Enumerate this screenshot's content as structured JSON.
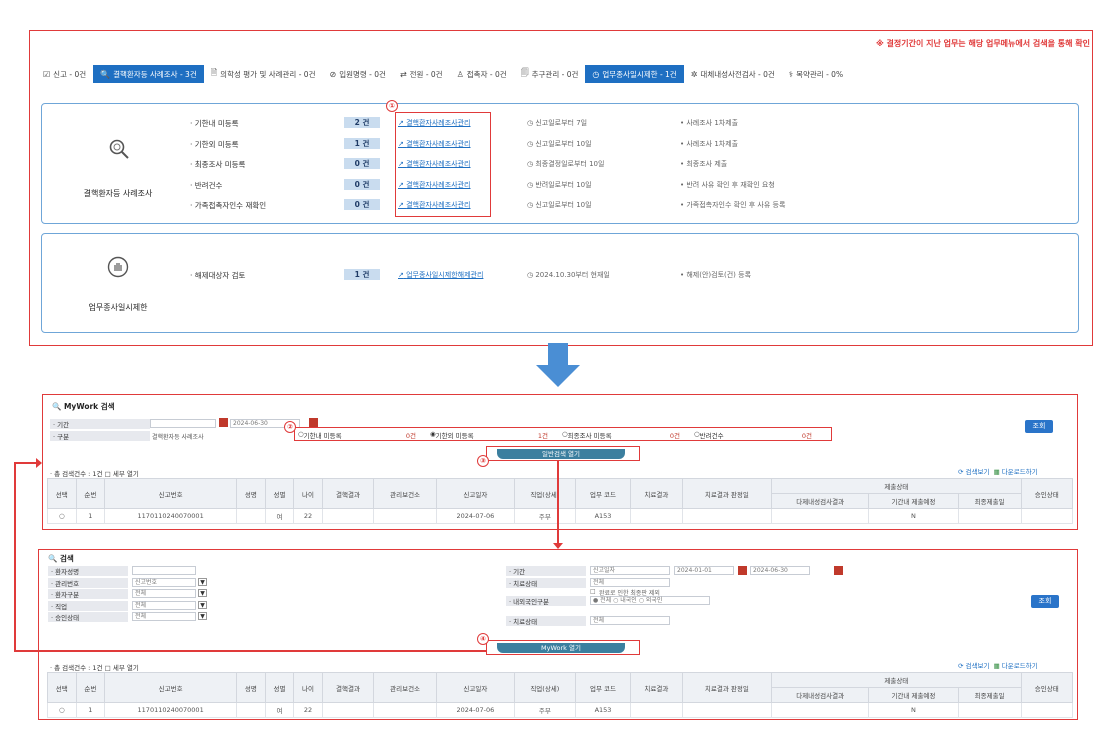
{
  "notice": "※ 결정기간이 지난 업무는 해당 업무메뉴에서 검색을 통해 확인",
  "tabs": [
    {
      "icon": "edit-icon",
      "glyph": "☑",
      "label": "신고 - 0건",
      "active": false
    },
    {
      "icon": "search-icon",
      "glyph": "🔍",
      "label": "결핵환자등 사례조사 - 3건",
      "active": true
    },
    {
      "icon": "document-icon",
      "glyph": "🗎",
      "label": "의학성 평가 및 사례관리 - 0건",
      "active": false
    },
    {
      "icon": "check-icon",
      "glyph": "⊘",
      "label": "입원명령 - 0건",
      "active": false
    },
    {
      "icon": "link-icon",
      "glyph": "⇄",
      "label": "전원 - 0건",
      "active": false
    },
    {
      "icon": "person-icon",
      "glyph": "♙",
      "label": "접촉자 - 0건",
      "active": false
    },
    {
      "icon": "clipboard-icon",
      "glyph": "🗐",
      "label": "추구관리 - 0건",
      "active": false
    },
    {
      "icon": "clock-icon",
      "glyph": "◷",
      "label": "업무종사일시제한 - 1건",
      "active": true
    },
    {
      "icon": "gear-icon",
      "glyph": "✲",
      "label": "대체내성사전검사 - 0건",
      "active": false
    },
    {
      "icon": "pill-icon",
      "glyph": "⚕",
      "label": "복약관리 - 0%",
      "active": false
    }
  ],
  "panel1": {
    "title": "결핵환자등 사례조사",
    "rows": [
      {
        "label": "· 기한내 미등록",
        "count": "2 건",
        "link": "결핵환자사례조사관리",
        "deadline": "신고일로부터 7일",
        "desc": "• 사례조사 1차제출"
      },
      {
        "label": "· 기한외 미등록",
        "count": "1 건",
        "link": "결핵환자사례조사관리",
        "deadline": "신고일로부터 10일",
        "desc": "• 사례조사 1차제출"
      },
      {
        "label": "· 최종조사 미등록",
        "count": "0 건",
        "link": "결핵환자사례조사관리",
        "deadline": "최종결정일로부터 10일",
        "desc": "• 최종조사 제출"
      },
      {
        "label": "· 반려건수",
        "count": "0 건",
        "link": "결핵환자사례조사관리",
        "deadline": "반려일로부터 10일",
        "desc": "• 반려 사유 확인 후 재확인 요청"
      },
      {
        "label": "· 가족접촉자인수 재확인",
        "count": "0 건",
        "link": "결핵환자사례조사관리",
        "deadline": "신고일로부터 10일",
        "desc": "• 가족접촉자인수 확인 후 사유 등록"
      }
    ]
  },
  "panel2": {
    "title": "업무종사일시제한",
    "row": {
      "label": "· 해제대상자 검토",
      "count": "1 건",
      "link": "업무종사일시제한해제관리",
      "deadline": "2024.10.30부터 현재일",
      "desc": "• 해제(안)검토(건) 등록"
    }
  },
  "markers": [
    "①",
    "②",
    "③",
    "④"
  ],
  "mywork": {
    "title": "MyWork 검색",
    "period_label": "· 기간",
    "date_from": "",
    "date_to": "2024-06-30",
    "type_label": "· 구분",
    "type_value": "결핵환자등 사례조사",
    "radios": [
      {
        "label": "기한내 미등록",
        "count": "0건",
        "checked": false
      },
      {
        "label": "기한외 미등록",
        "count": "1건",
        "checked": true
      },
      {
        "label": "최종조사 미등록",
        "count": "0건",
        "checked": false
      },
      {
        "label": "반려건수",
        "count": "0건",
        "checked": false
      }
    ],
    "search_btn": "조회",
    "toggle_label": "일반검색 열기",
    "total_label": "· 총 검색건수 : 1건",
    "all_check": "□ 세부 열기",
    "action_reset": "검색보기",
    "action_excel": "다운로드하기"
  },
  "table_headers": [
    "선택",
    "순번",
    "신고번호",
    "성명",
    "성별",
    "나이",
    "결핵결과",
    "관리보건소",
    "신고일자",
    "직업(상세)",
    "업무 코드",
    "치료결과",
    "치료결과 판정일",
    "다제내성검사결과",
    "기간내 제출예정",
    "최종제출일",
    "승인상태"
  ],
  "table_header_group": "제출상태",
  "table_row": {
    "no": "1",
    "report": "1170110240070001",
    "name": "",
    "sex": "여",
    "age": "22",
    "result": "",
    "center": "",
    "date": "2024-07-06",
    "job": "주부",
    "code": "A153",
    "treat": "",
    "treat_date": "",
    "mdr": "",
    "due": "N",
    "final": "",
    "status": ""
  },
  "search2": {
    "title": "검색",
    "fields_left": [
      {
        "label": "· 환자성명",
        "value": ""
      },
      {
        "label": "· 관리번호",
        "value": "신고번호"
      },
      {
        "label": "· 환자구분",
        "value": "전체"
      },
      {
        "label": "· 직업",
        "value": "전체"
      },
      {
        "label": "· 승인상태",
        "value": "전체"
      }
    ],
    "fields_right": [
      {
        "label": "· 기간",
        "value": "신고일자"
      },
      {
        "label": "· 치료상태",
        "value": "전체"
      },
      {
        "label": "· 내외국인구분",
        "value": "● 전체 ○ 내국인 ○ 외국인"
      },
      {
        "label": "· 치료상태",
        "value": "전체"
      }
    ],
    "date_from": "2024-01-01",
    "date_to": "2024-06-30",
    "checkbox_text": "완료로 인한 최종판 제외",
    "search_btn": "조회",
    "toggle_label": "MyWork 열기",
    "total_label": "· 총 검색건수 : 1건",
    "all_check": "□ 세부 열기",
    "action_reset": "검색보기",
    "action_excel": "다운로드하기"
  },
  "table_row2": {
    "no": "1",
    "report": "1170110240070001",
    "name": "",
    "sex": "여",
    "age": "22",
    "result": "",
    "center": "",
    "date": "2024-07-06",
    "job": "주부",
    "code": "A153",
    "treat": "",
    "treat_date": "",
    "mdr": "",
    "due": "N",
    "final": "",
    "status": ""
  }
}
